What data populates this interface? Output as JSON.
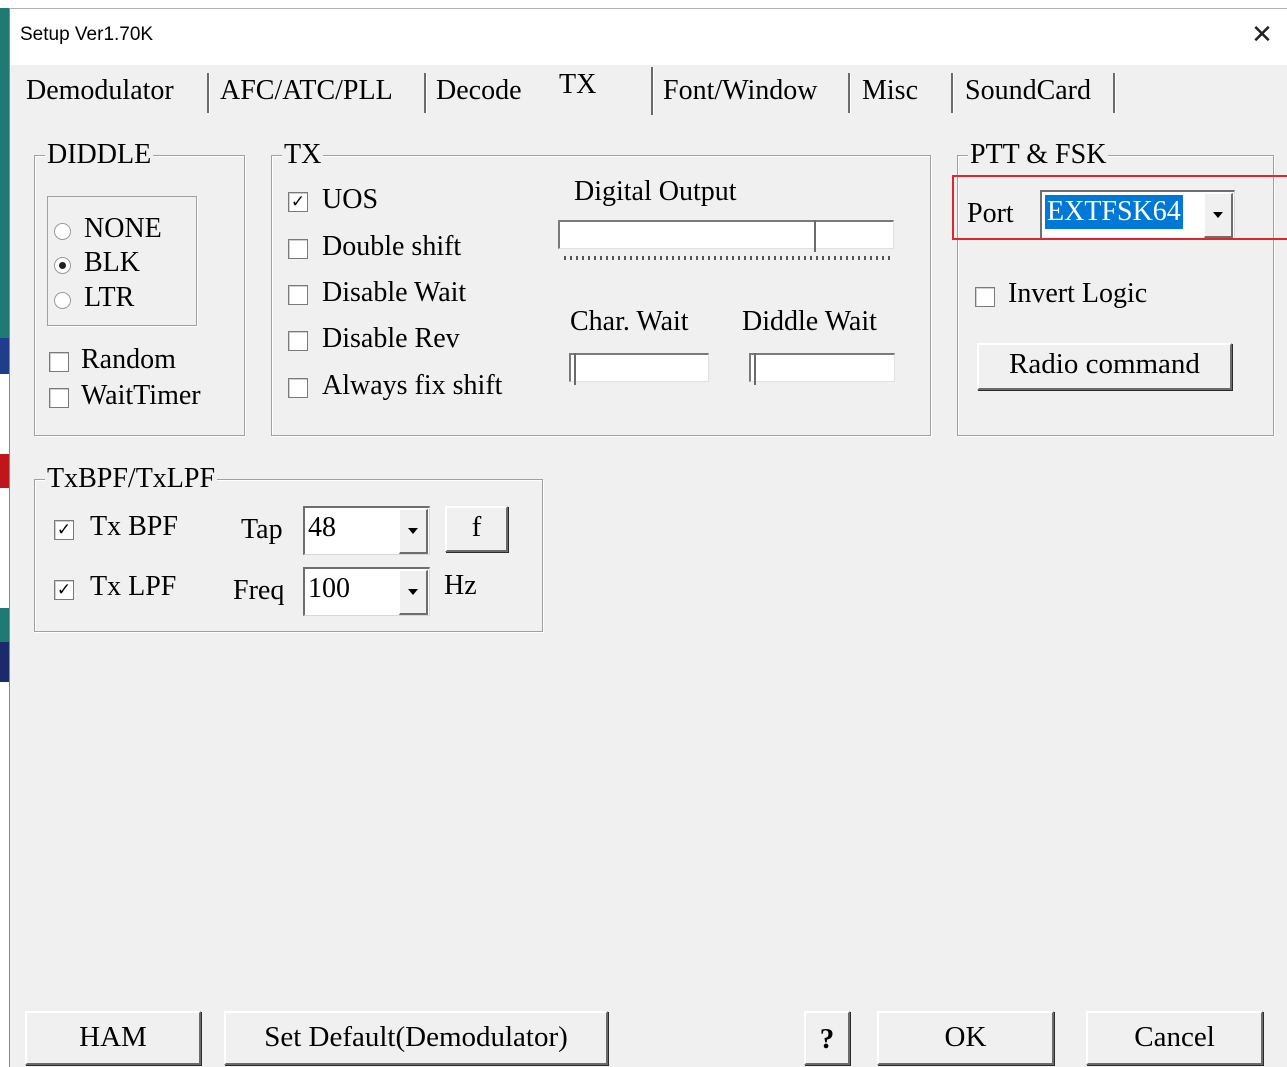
{
  "window": {
    "title": "Setup Ver1.70K",
    "close_glyph": "✕"
  },
  "tabs": [
    {
      "label": "Demodulator"
    },
    {
      "label": "AFC/ATC/PLL"
    },
    {
      "label": "Decode"
    },
    {
      "label": "TX",
      "active": true
    },
    {
      "label": "Font/Window"
    },
    {
      "label": "Misc"
    },
    {
      "label": "SoundCard"
    }
  ],
  "diddle": {
    "title": "DIDDLE",
    "options": [
      {
        "label": "NONE",
        "selected": false
      },
      {
        "label": "BLK",
        "selected": true
      },
      {
        "label": "LTR",
        "selected": false
      }
    ],
    "random": {
      "label": "Random",
      "checked": false
    },
    "waittimer": {
      "label": "WaitTimer",
      "checked": false
    }
  },
  "tx": {
    "title": "TX",
    "uos": {
      "label": "UOS",
      "checked": true
    },
    "double_shift": {
      "label": "Double shift",
      "checked": false
    },
    "disable_wait": {
      "label": "Disable Wait",
      "checked": false
    },
    "disable_rev": {
      "label": "Disable Rev",
      "checked": false
    },
    "always_fix_shift": {
      "label": "Always fix shift",
      "checked": false
    },
    "digital_output": {
      "label": "Digital Output"
    },
    "char_wait": {
      "label": "Char. Wait"
    },
    "diddle_wait": {
      "label": "Diddle Wait"
    }
  },
  "ptt": {
    "title": "PTT & FSK",
    "port_label": "Port",
    "port_value": "EXTFSK64",
    "invert_logic": {
      "label": "Invert Logic",
      "checked": false
    },
    "radio_command": "Radio command"
  },
  "txfilter": {
    "title": "TxBPF/TxLPF",
    "tx_bpf": {
      "label": "Tx BPF",
      "checked": true
    },
    "tap_label": "Tap",
    "tap_value": "48",
    "f_button": "f",
    "tx_lpf": {
      "label": "Tx LPF",
      "checked": true
    },
    "freq_label": "Freq",
    "freq_value": "100",
    "hz_label": "Hz"
  },
  "footer": {
    "ham": "HAM",
    "set_default": "Set Default(Demodulator)",
    "help": "?",
    "ok": "OK",
    "cancel": "Cancel"
  },
  "colors": {
    "highlight_box": "#e0262c",
    "selection_bg": "#0078d7",
    "dialog_bg": "#f0f0f0"
  },
  "check_glyph": "✓"
}
